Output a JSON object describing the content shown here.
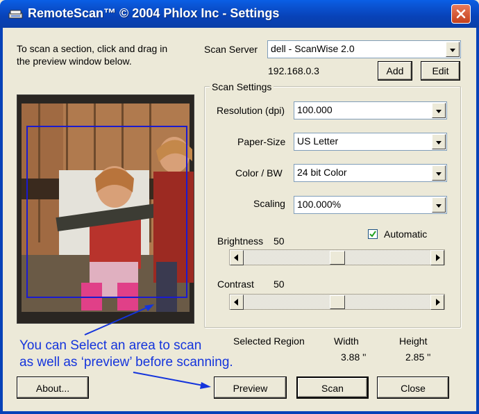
{
  "window": {
    "title": "RemoteScan™ © 2004 Phlox Inc - Settings"
  },
  "instructions": {
    "line1": "To scan a section, click and drag in",
    "line2": "the preview window below."
  },
  "scan_server": {
    "label": "Scan Server",
    "value": "dell - ScanWise 2.0",
    "ip": "192.168.0.3",
    "add_label": "Add",
    "edit_label": "Edit"
  },
  "scan_settings": {
    "legend": "Scan Settings",
    "resolution": {
      "label": "Resolution (dpi)",
      "value": "100.000"
    },
    "paper_size": {
      "label": "Paper-Size",
      "value": "US Letter"
    },
    "color_bw": {
      "label": "Color / BW",
      "value": "24 bit Color"
    },
    "scaling": {
      "label": "Scaling",
      "value": "100.000%"
    },
    "automatic": {
      "label": "Automatic",
      "checked": true
    },
    "brightness": {
      "label": "Brightness",
      "value": "50",
      "level": 0.5
    },
    "contrast": {
      "label": "Contrast",
      "value": "50",
      "level": 0.5
    }
  },
  "selected_region": {
    "label": "Selected Region",
    "width_label": "Width",
    "height_label": "Height",
    "width_value": "3.88 ''",
    "height_value": "2.85 ''"
  },
  "annotation": {
    "line1": "You can Select an area to scan",
    "line2": "as well as ‘preview’ before scanning."
  },
  "buttons": {
    "about": "About...",
    "preview": "Preview",
    "scan": "Scan",
    "close": "Close"
  },
  "colors": {
    "title_bar": "#0a57d8",
    "annotation": "#1434dc",
    "selection": "#1a1ad0",
    "close_button": "#d6542c"
  }
}
